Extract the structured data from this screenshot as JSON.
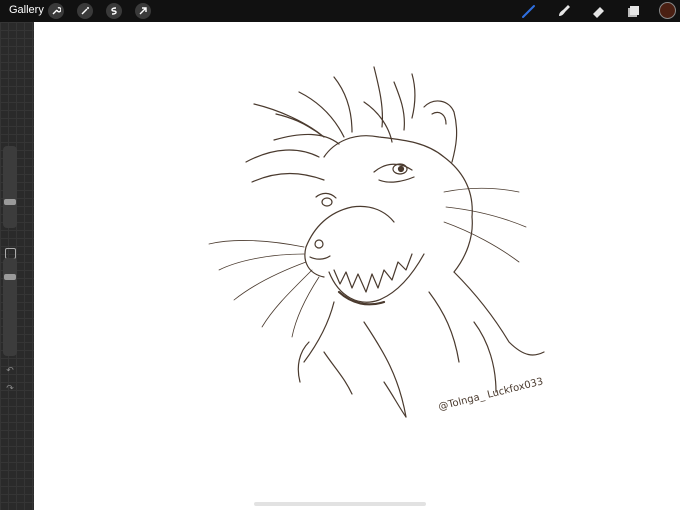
{
  "topbar": {
    "gallery_label": "Gallery",
    "left_tools": [
      "wrench-icon",
      "magic-wand-icon",
      "selection-icon",
      "transform-arrow-icon"
    ],
    "right_tools": [
      "brush-icon",
      "smudge-icon",
      "eraser-icon",
      "layers-icon"
    ],
    "current_color": "#4a1f12",
    "accent_color": "#2f6fe0"
  },
  "sidebar": {
    "brush_size": 0.3,
    "opacity": 0.9,
    "icons": [
      "modify-square-icon",
      "undo-icon",
      "redo-icon"
    ]
  },
  "canvas": {
    "background": "#ffffff",
    "line_color": "#4a3a2e",
    "signature_text": "@Tolnga_  Luckfox033"
  }
}
